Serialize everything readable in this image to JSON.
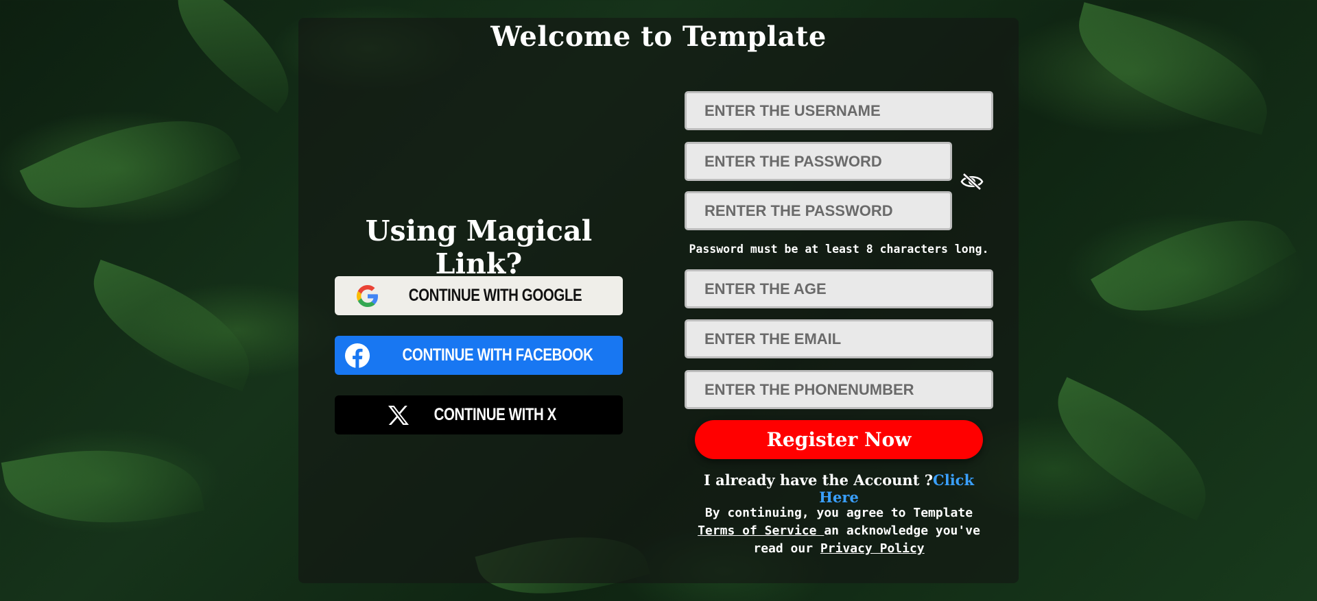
{
  "page": {
    "title": "Welcome to Template"
  },
  "social": {
    "heading": "Using Magical Link?",
    "google_label": "CONTINUE WITH GOOGLE",
    "facebook_label": "CONTINUE WITH FACEBOOK",
    "x_label": "CONTINUE WITH X",
    "icons": [
      "google-icon",
      "facebook-icon",
      "x-icon"
    ]
  },
  "form": {
    "username_placeholder": "ENTER THE USERNAME",
    "password_placeholder": "ENTER THE PASSWORD",
    "repassword_placeholder": "RENTER THE PASSWORD",
    "password_hint": "Password must be at least 8 characters long.",
    "age_placeholder": "ENTER THE AGE",
    "email_placeholder": "ENTER THE EMAIL",
    "phone_placeholder": "ENTER THE PHONENUMBER",
    "toggle_icon": "eye-slash-icon",
    "register_label": "Register Now",
    "account_text": "I already have the Account ?",
    "account_link": "Click Here"
  },
  "terms": {
    "prefix": "By continuing, you agree to Template ",
    "tos_link": "Terms of Service ",
    "middle": "an acknowledge you've read our ",
    "privacy_link": "Privacy Policy"
  },
  "colors": {
    "google_bg": "#efeee9",
    "facebook_bg": "#1877f2",
    "x_bg": "#000000",
    "register_bg": "#ff0000",
    "link": "#3aa0ff"
  }
}
